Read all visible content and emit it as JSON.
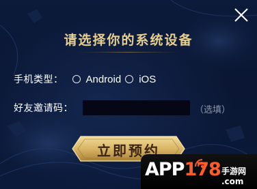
{
  "dialog": {
    "title": "请选择你的系统设备",
    "close_icon": "close-icon"
  },
  "device": {
    "label": "手机类型：",
    "options": [
      "Android",
      "iOS"
    ],
    "selected": null
  },
  "invite": {
    "label": "好友邀请码：",
    "value": "",
    "placeholder": "",
    "hint": "（选填）"
  },
  "submit": {
    "label": "立即预约"
  },
  "watermark": {
    "brand_prefix": "APP",
    "brand_number": "178",
    "brand_suffix": "手游网",
    "domain": ".com"
  },
  "colors": {
    "background": "#0b1a3a",
    "title": "#e6cf8f",
    "button_gold": "#d9b566",
    "button_text": "#3a2410",
    "hint": "#8d96ab"
  }
}
